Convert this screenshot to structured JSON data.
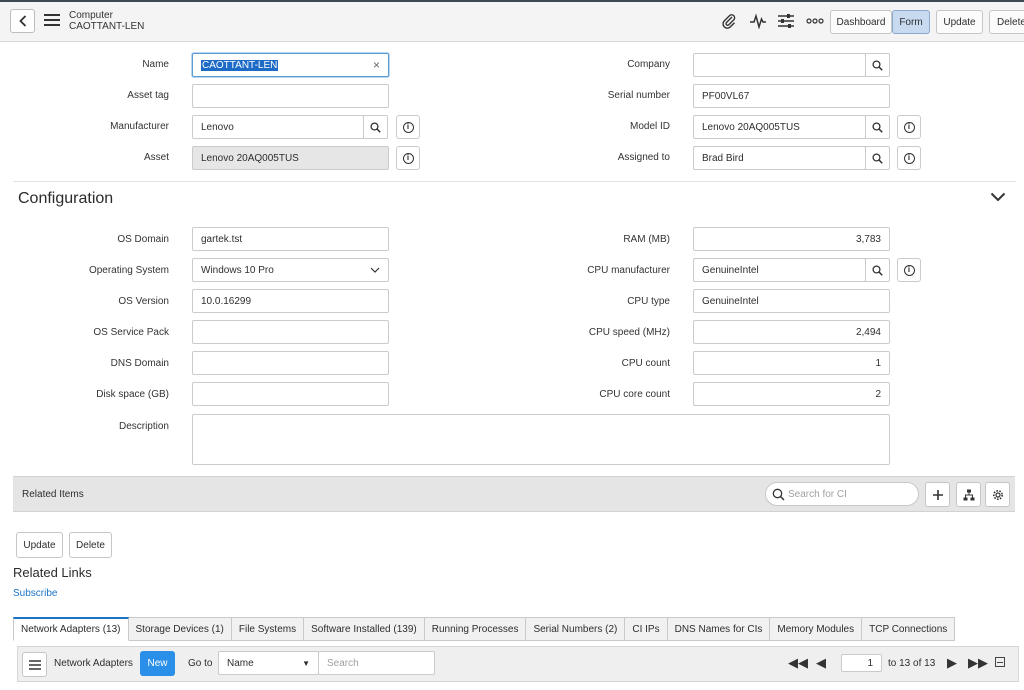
{
  "header": {
    "record_type": "Computer",
    "record_name": "CAOTTANT-LEN",
    "icons": [
      "paperclip-icon",
      "activity-icon",
      "sliders-icon",
      "more-icon"
    ],
    "buttons": {
      "dashboard": "Dashboard",
      "form": "Form",
      "update": "Update",
      "delete": "Delete"
    }
  },
  "form": {
    "name": {
      "label": "Name",
      "value": "CAOTTANT-LEN"
    },
    "asset_tag": {
      "label": "Asset tag",
      "value": ""
    },
    "manufacturer": {
      "label": "Manufacturer",
      "value": "Lenovo"
    },
    "asset": {
      "label": "Asset",
      "value": "Lenovo 20AQ005TUS"
    },
    "company": {
      "label": "Company",
      "value": ""
    },
    "serial_number": {
      "label": "Serial number",
      "value": "PF00VL67"
    },
    "model_id": {
      "label": "Model ID",
      "value": "Lenovo 20AQ005TUS"
    },
    "assigned_to": {
      "label": "Assigned to",
      "value": "Brad Bird"
    }
  },
  "configuration": {
    "title": "Configuration",
    "os_domain": {
      "label": "OS Domain",
      "value": "gartek.tst"
    },
    "operating_system": {
      "label": "Operating System",
      "value": "Windows 10 Pro"
    },
    "os_version": {
      "label": "OS Version",
      "value": "10.0.16299"
    },
    "os_service_pack": {
      "label": "OS Service Pack",
      "value": ""
    },
    "dns_domain": {
      "label": "DNS Domain",
      "value": ""
    },
    "disk_space": {
      "label": "Disk space (GB)",
      "value": ""
    },
    "description": {
      "label": "Description",
      "value": ""
    },
    "ram": {
      "label": "RAM (MB)",
      "value": "3,783"
    },
    "cpu_manufacturer": {
      "label": "CPU manufacturer",
      "value": "GenuineIntel"
    },
    "cpu_type": {
      "label": "CPU type",
      "value": "GenuineIntel"
    },
    "cpu_speed": {
      "label": "CPU speed (MHz)",
      "value": "2,494"
    },
    "cpu_count": {
      "label": "CPU count",
      "value": "1"
    },
    "cpu_core_count": {
      "label": "CPU core count",
      "value": "2"
    }
  },
  "related_items": {
    "title": "Related Items",
    "search_placeholder": "Search for CI"
  },
  "actions": {
    "update": "Update",
    "delete": "Delete"
  },
  "related_links": {
    "title": "Related Links",
    "subscribe": "Subscribe"
  },
  "tabs": [
    "Network Adapters (13)",
    "Storage Devices (1)",
    "File Systems",
    "Software Installed (139)",
    "Running Processes",
    "Serial Numbers (2)",
    "CI IPs",
    "DNS Names for CIs",
    "Memory Modules",
    "TCP Connections"
  ],
  "list": {
    "title": "Network Adapters",
    "new_label": "New",
    "goto_label": "Go to",
    "goto_field": "Name",
    "search_placeholder": "Search",
    "page_value": "1",
    "page_text": "to 13 of 13"
  },
  "colors": {
    "accent": "#1a73c7",
    "new_button": "#2a8fe8",
    "active_button": "#c8daf0"
  }
}
